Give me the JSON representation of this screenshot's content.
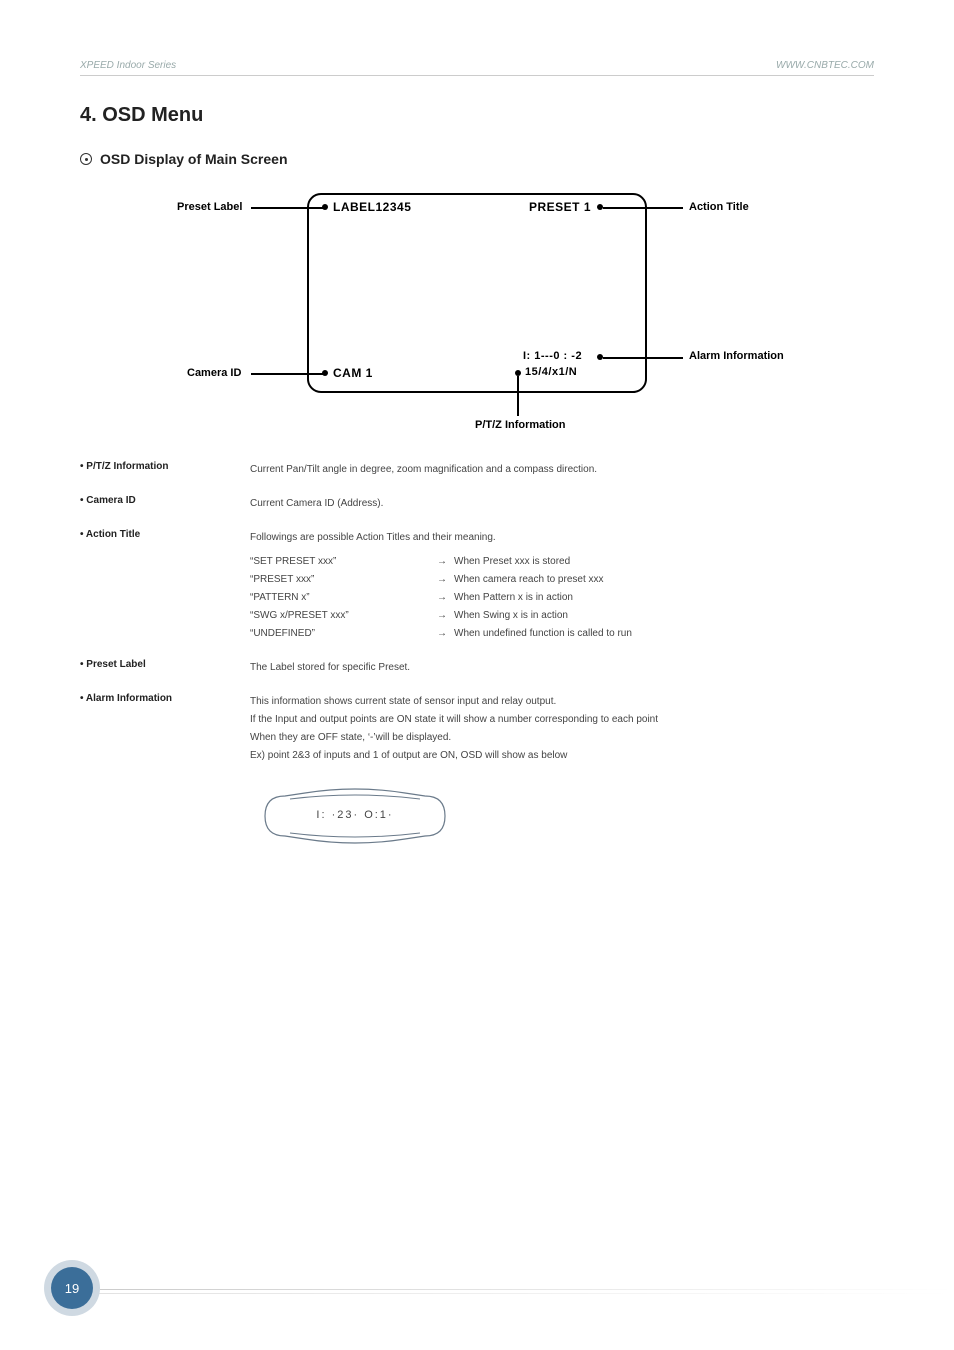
{
  "header": {
    "left": "XPEED Indoor Series",
    "right": "WWW.CNBTEC.COM"
  },
  "section": {
    "title": "4. OSD Menu",
    "sub": "OSD Display of Main Screen"
  },
  "diagram": {
    "preset_label_caption": "Preset Label",
    "label_text": "LABEL12345",
    "preset_text": "PRESET 1",
    "action_title_caption": "Action Title",
    "camera_id_caption": "Camera ID",
    "cam_text": "CAM 1",
    "alarm_text": "I: 1---0 : -2",
    "ptz_text": "15/4/x1/N",
    "alarm_caption": "Alarm Information",
    "ptz_caption": "P/T/Z Information"
  },
  "defs": {
    "ptz": {
      "label": "P/T/Z Information",
      "body": "Current Pan/Tilt angle in degree, zoom magnification and a compass direction."
    },
    "camera_id": {
      "label": "Camera ID",
      "body": "Current Camera ID (Address)."
    },
    "action_title": {
      "label": "Action Title",
      "intro": "Followings are possible Action Titles and their meaning.",
      "rows": [
        {
          "left": "“SET PRESET xxx”",
          "right": "When Preset xxx is stored"
        },
        {
          "left": "“PRESET xxx”",
          "right": "When camera reach to preset xxx"
        },
        {
          "left": "“PATTERN x”",
          "right": "When Pattern x is in action"
        },
        {
          "left": "“SWG x/PRESET xxx”",
          "right": "When Swing x is in action"
        },
        {
          "left": "“UNDEFINED”",
          "right": "When undefined function is called to run"
        }
      ]
    },
    "preset_label": {
      "label": "Preset Label",
      "body": "The Label stored for specific Preset."
    },
    "alarm": {
      "label": "Alarm Information",
      "lines": [
        "This information shows current state of sensor input and relay output.",
        "If the Input and output points are ON state it will show a number corresponding to each point",
        "When they are OFF state, ‘-’will be displayed.",
        "Ex) point 2&3 of inputs and 1 of output are ON, OSD will show as below"
      ],
      "example_text": "I: ·23· O:1·"
    }
  },
  "page_number": "19"
}
